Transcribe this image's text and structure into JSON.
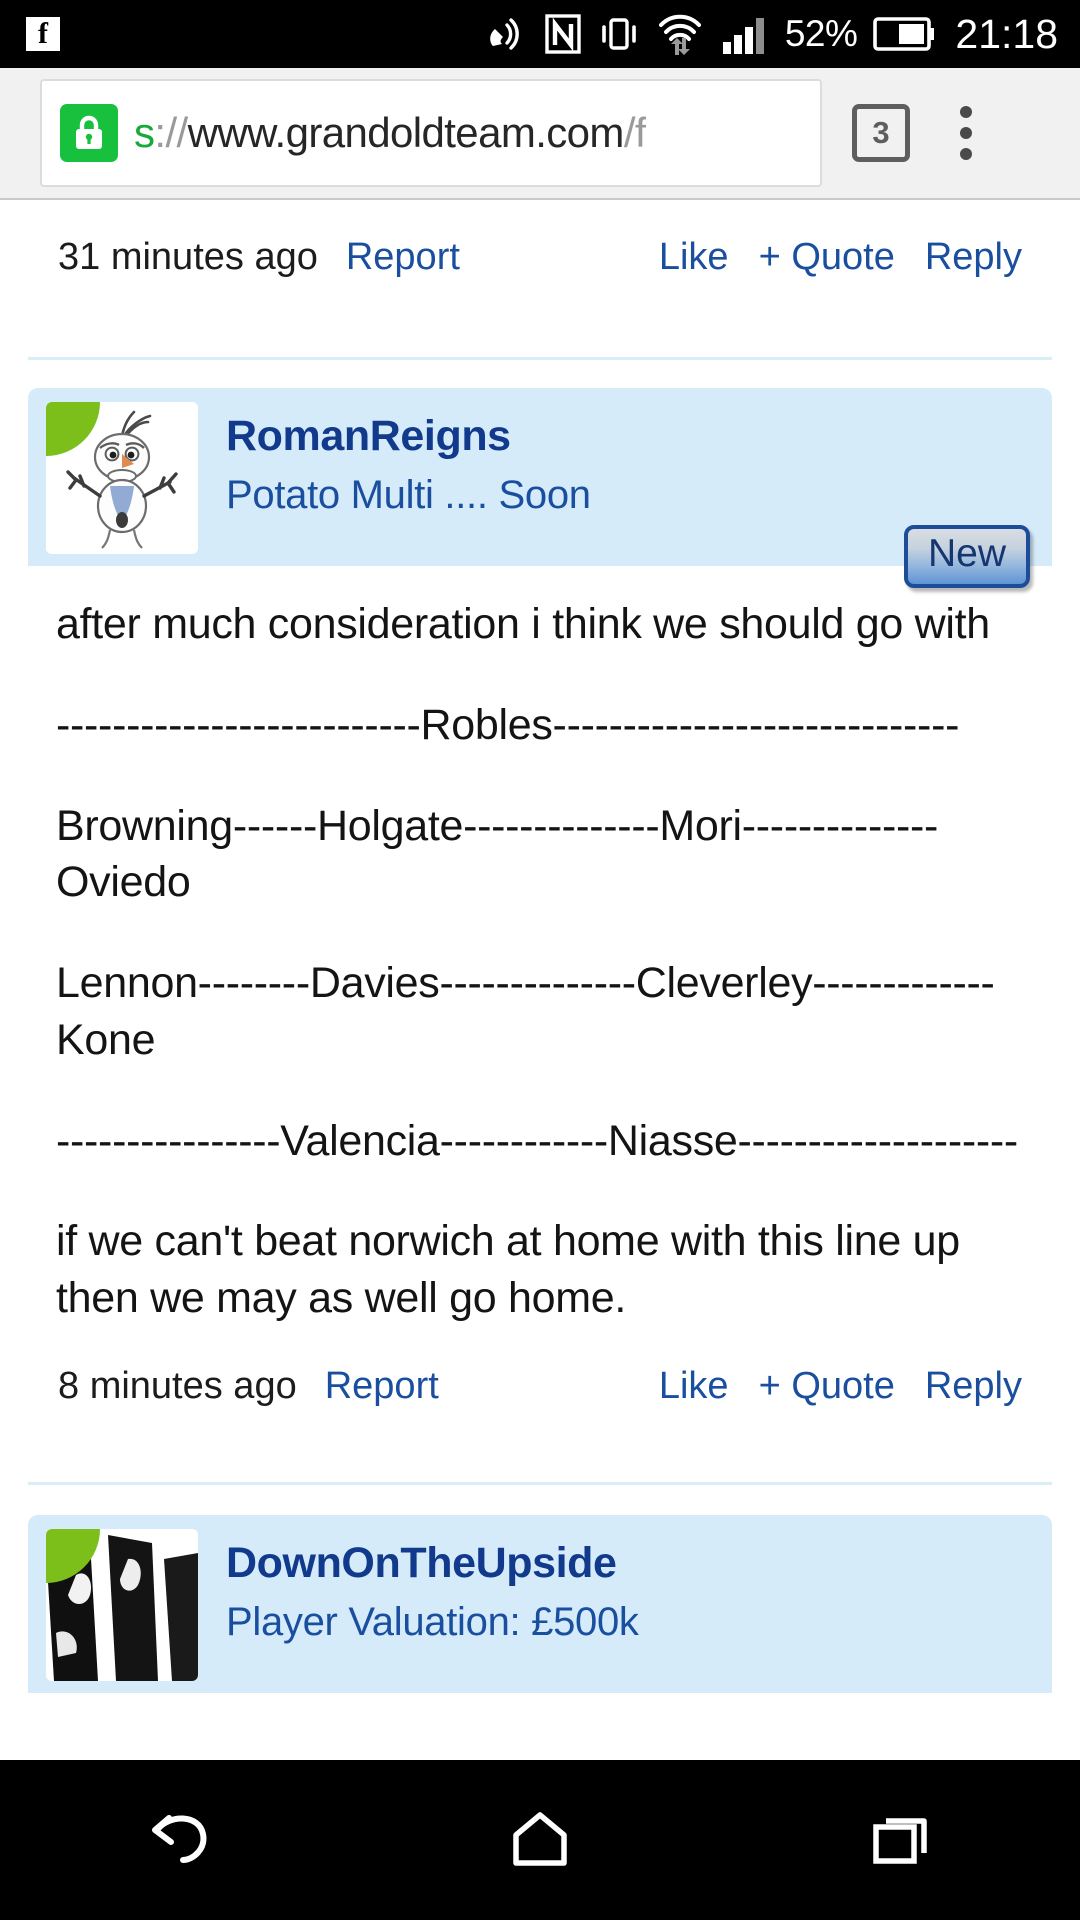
{
  "status_bar": {
    "facebook_glyph": "f",
    "battery_percent": "52%",
    "time": "21:18",
    "icons": [
      "facebook-icon",
      "call-speaker-icon",
      "nfc-icon",
      "vibrate-icon",
      "wifi-icon",
      "signal-bars-icon",
      "battery-icon"
    ]
  },
  "browser": {
    "url_secure_prefix": "s",
    "url_scheme_rest": "://",
    "url_host": "www.grandoldteam.com",
    "url_path": "/f",
    "tab_count": "3",
    "menu_icon": "more-vertical-icon",
    "lock_icon": "lock-icon"
  },
  "thread": {
    "previous_post_footer": {
      "time": "31 minutes ago",
      "report": "Report",
      "like": "Like",
      "quote": "+ Quote",
      "reply": "Reply"
    },
    "posts": [
      {
        "username": "RomanReigns",
        "tagline": "Potato Multi .... Soon",
        "badge": "New",
        "avatar": "olaf-snowman-avatar",
        "body": [
          "after much consideration i think we should go with",
          "--------------------------Robles-----------------------------",
          "Browning------Holgate--------------Mori--------------Oviedo",
          "Lennon--------Davies--------------Cleverley-------------Kone",
          "----------------Valencia------------Niasse--------------------",
          "if we can't beat norwich at home with this line up then we may as well go home."
        ],
        "footer": {
          "time": "8 minutes ago",
          "report": "Report",
          "like": "Like",
          "quote": "+ Quote",
          "reply": "Reply"
        }
      },
      {
        "username": "DownOnTheUpside",
        "tagline": "Player Valuation: £500k",
        "avatar": "black-white-photo-avatar"
      }
    ]
  },
  "navigation_bar": {
    "back": "back-icon",
    "home": "home-icon",
    "recents": "recents-icon"
  },
  "colors": {
    "link": "#1a4fa0",
    "username": "#123a8c",
    "post_header_bg": "#d6ebf9",
    "lock_green": "#17c13e",
    "flag_green": "#7dbf1a",
    "divider": "#d9eef7"
  }
}
